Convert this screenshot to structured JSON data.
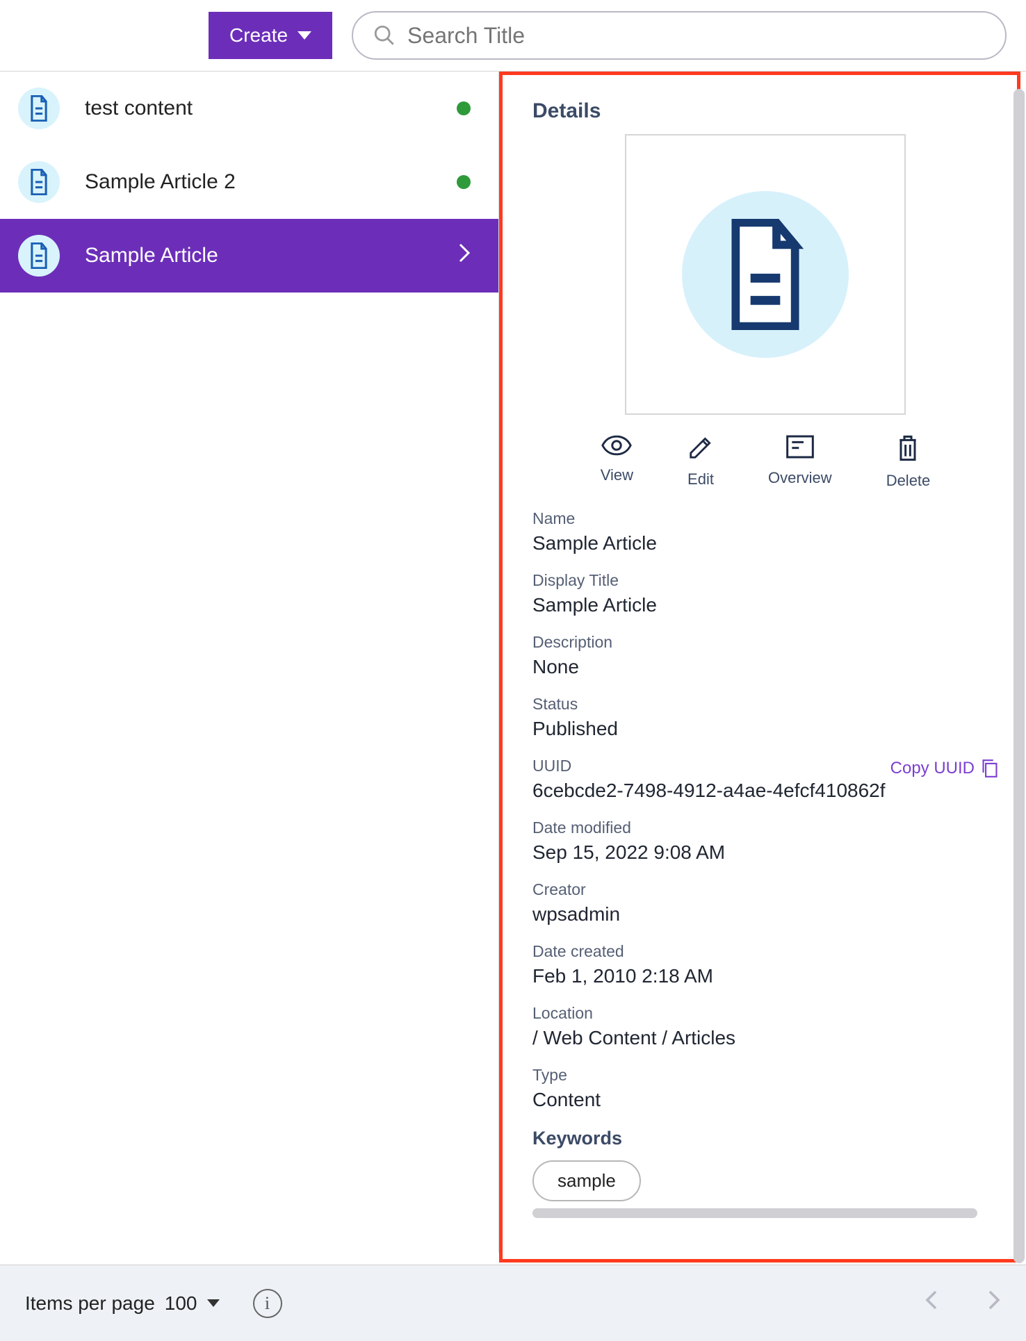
{
  "toolbar": {
    "create_label": "Create",
    "search_placeholder": "Search Title"
  },
  "list": {
    "items": [
      {
        "label": "test content",
        "status": "published",
        "selected": false
      },
      {
        "label": "Sample Article 2",
        "status": "published",
        "selected": false
      },
      {
        "label": "Sample Article",
        "status": "",
        "selected": true
      }
    ]
  },
  "details": {
    "title": "Details",
    "actions": {
      "view": "View",
      "edit": "Edit",
      "overview": "Overview",
      "delete": "Delete"
    },
    "fields": {
      "name_label": "Name",
      "name_value": "Sample Article",
      "display_title_label": "Display Title",
      "display_title_value": "Sample Article",
      "description_label": "Description",
      "description_value": "None",
      "status_label": "Status",
      "status_value": "Published",
      "uuid_label": "UUID",
      "uuid_value": "6cebcde2-7498-4912-a4ae-4efcf410862f",
      "copy_uuid_label": "Copy UUID",
      "date_modified_label": "Date modified",
      "date_modified_value": "Sep 15, 2022 9:08 AM",
      "creator_label": "Creator",
      "creator_value": "wpsadmin",
      "date_created_label": "Date created",
      "date_created_value": "Feb 1, 2010 2:18 AM",
      "location_label": "Location",
      "location_value": "/ Web Content / Articles",
      "type_label": "Type",
      "type_value": "Content"
    },
    "keywords_title": "Keywords",
    "keywords": [
      "sample"
    ]
  },
  "footer": {
    "items_per_page_label": "Items per page",
    "items_per_page_value": "100"
  }
}
